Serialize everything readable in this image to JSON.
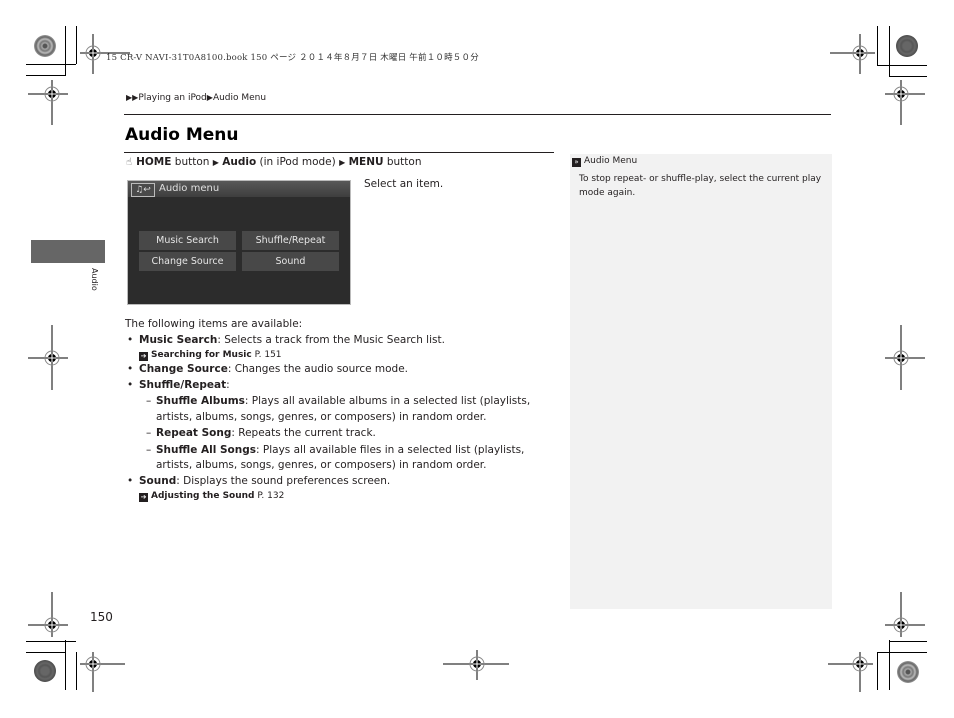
{
  "printer_slug": "15 CR-V NAVI-31T0A8100.book  150 ページ  ２０１４年８月７日  木曜日  午前１０時５０分",
  "breadcrumb": {
    "icon": "double-triangle-right-icon",
    "items": [
      "Playing an iPod",
      "Audio Menu"
    ]
  },
  "page_title": "Audio Menu",
  "nav_path": {
    "icon": "hand-icon",
    "parts": [
      {
        "bold": "HOME",
        "text": " button"
      },
      {
        "bold": "Audio",
        "text": " (in iPod mode)"
      },
      {
        "bold": "MENU",
        "text": " button"
      }
    ]
  },
  "screen": {
    "icon": "music-back-icon",
    "title": "Audio menu",
    "buttons": [
      "Music Search",
      "Shuffle/Repeat",
      "Change Source",
      "Sound"
    ]
  },
  "select_instruction": "Select an item.",
  "intro": "The following items are available:",
  "items": [
    {
      "term": "Music Search",
      "desc": ": Selects a track from the Music Search list.",
      "xref": {
        "label": "Searching for Music",
        "page": "P. 151"
      }
    },
    {
      "term": "Change Source",
      "desc": ": Changes the audio source mode."
    },
    {
      "term": "Shuffle/Repeat",
      "desc": ":",
      "subitems": [
        {
          "term": "Shuffle Albums",
          "desc": ": Plays all available albums in a selected list (playlists, artists, albums, songs, genres, or composers) in random order."
        },
        {
          "term": "Repeat Song",
          "desc": ": Repeats the current track."
        },
        {
          "term": "Shuffle All Songs",
          "desc": ": Plays all available files in a selected list (playlists, artists, albums, songs, genres, or composers) in random order."
        }
      ]
    },
    {
      "term": "Sound",
      "desc": ": Displays the sound preferences screen.",
      "xref": {
        "label": "Adjusting the Sound",
        "page": "P. 132"
      }
    }
  ],
  "side_note": {
    "icon": "note-icon",
    "title": "Audio Menu",
    "text": "To stop repeat- or shuffle-play, select the current play mode again."
  },
  "section_tab": "Audio",
  "page_number": "150",
  "colors": {
    "tab": "#666666",
    "note_bg": "#f2f2f2",
    "screen_bg": "#2c2c2c"
  }
}
